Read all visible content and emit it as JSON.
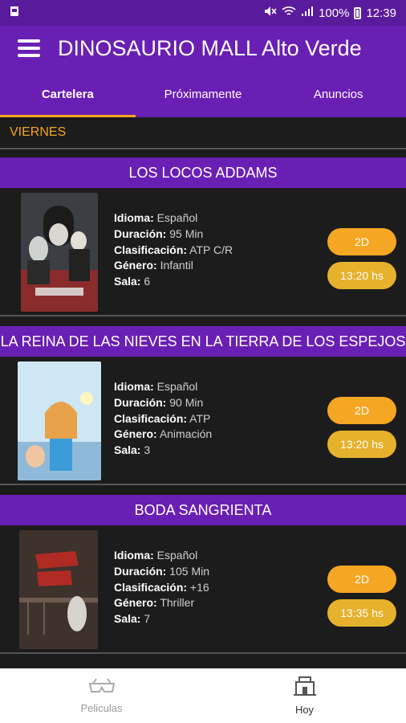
{
  "status": {
    "percent": "100%",
    "time": "12:39"
  },
  "app": {
    "title": "DINOSAURIO MALL Alto Verde"
  },
  "tabs": [
    {
      "label": "Cartelera"
    },
    {
      "label": "Próximamente"
    },
    {
      "label": "Anuncios"
    }
  ],
  "day": "VIERNES",
  "labels": {
    "idioma": "Idioma:",
    "duracion": "Duración:",
    "clasificacion": "Clasificación:",
    "genero": "Género:",
    "sala": "Sala:"
  },
  "movies": [
    {
      "title": "LOS LOCOS ADDAMS",
      "idioma": "Español",
      "duracion": "95 Min",
      "clasificacion": "ATP C/R",
      "genero": "Infantil",
      "sala": "6",
      "format": "2D",
      "time": "13:20 hs"
    },
    {
      "title": "LA REINA DE LAS NIEVES  EN LA TIERRA DE LOS ESPEJOS",
      "idioma": "Español",
      "duracion": "90 Min",
      "clasificacion": "ATP",
      "genero": "Animación",
      "sala": "3",
      "format": "2D",
      "time": "13:20 hs"
    },
    {
      "title": "BODA SANGRIENTA",
      "idioma": "Español",
      "duracion": "105 Min",
      "clasificacion": "+16",
      "genero": "Thriller",
      "sala": "7",
      "format": "2D",
      "time": "13:35 hs"
    }
  ],
  "bottom_nav": [
    {
      "label": "Peliculas"
    },
    {
      "label": "Hoy"
    }
  ],
  "colors": {
    "primary": "#6a1fb4",
    "accent": "#f5a623",
    "background": "#1c1c1c"
  }
}
